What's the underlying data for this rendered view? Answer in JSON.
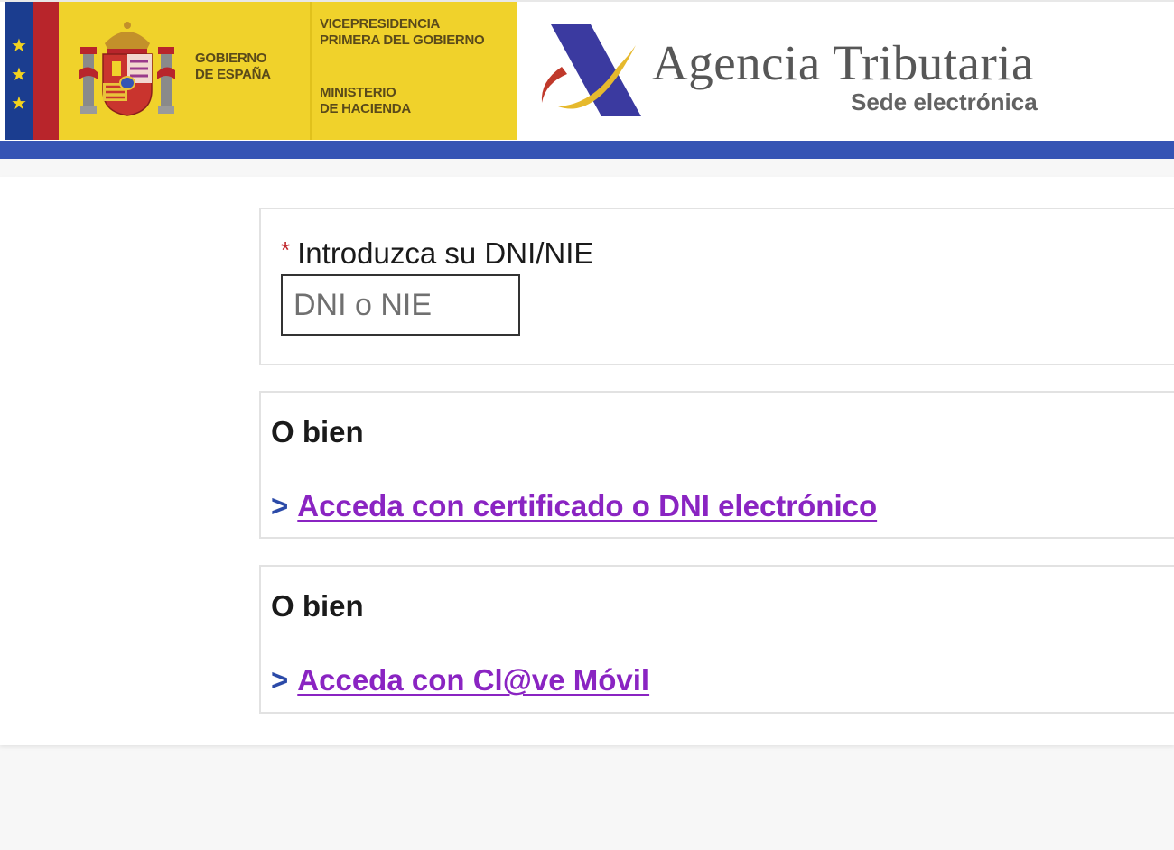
{
  "header": {
    "government_label": "GOBIERNO\nDE ESPAÑA",
    "vicepresidency_label": "VICEPRESIDENCIA\nPRIMERA DEL GOBIERNO",
    "ministry_label": "MINISTERIO\nDE HACIENDA",
    "agency_title": "Agencia Tributaria",
    "agency_subtitle": "Sede electrónica",
    "eu_star_glyph": "★",
    "colors": {
      "brand_yellow": "#f0d22b",
      "brand_blue": "#3554b4",
      "eu_blue": "#1b3d8f",
      "flag_red": "#b8252b"
    }
  },
  "identification": {
    "required_mark": "*",
    "label": "Introduzca su DNI/NIE",
    "input_placeholder": "DNI o NIE",
    "input_value": ""
  },
  "alternatives": [
    {
      "heading": "O bien",
      "chevron": ">",
      "link_text": "Acceda con certificado o DNI electrónico"
    },
    {
      "heading": "O bien",
      "chevron": ">",
      "link_text": "Acceda con Cl@ve Móvil"
    }
  ],
  "colors": {
    "link_visited": "#8a24c2",
    "chevron": "#2b4aa8",
    "required": "#c0282d"
  }
}
